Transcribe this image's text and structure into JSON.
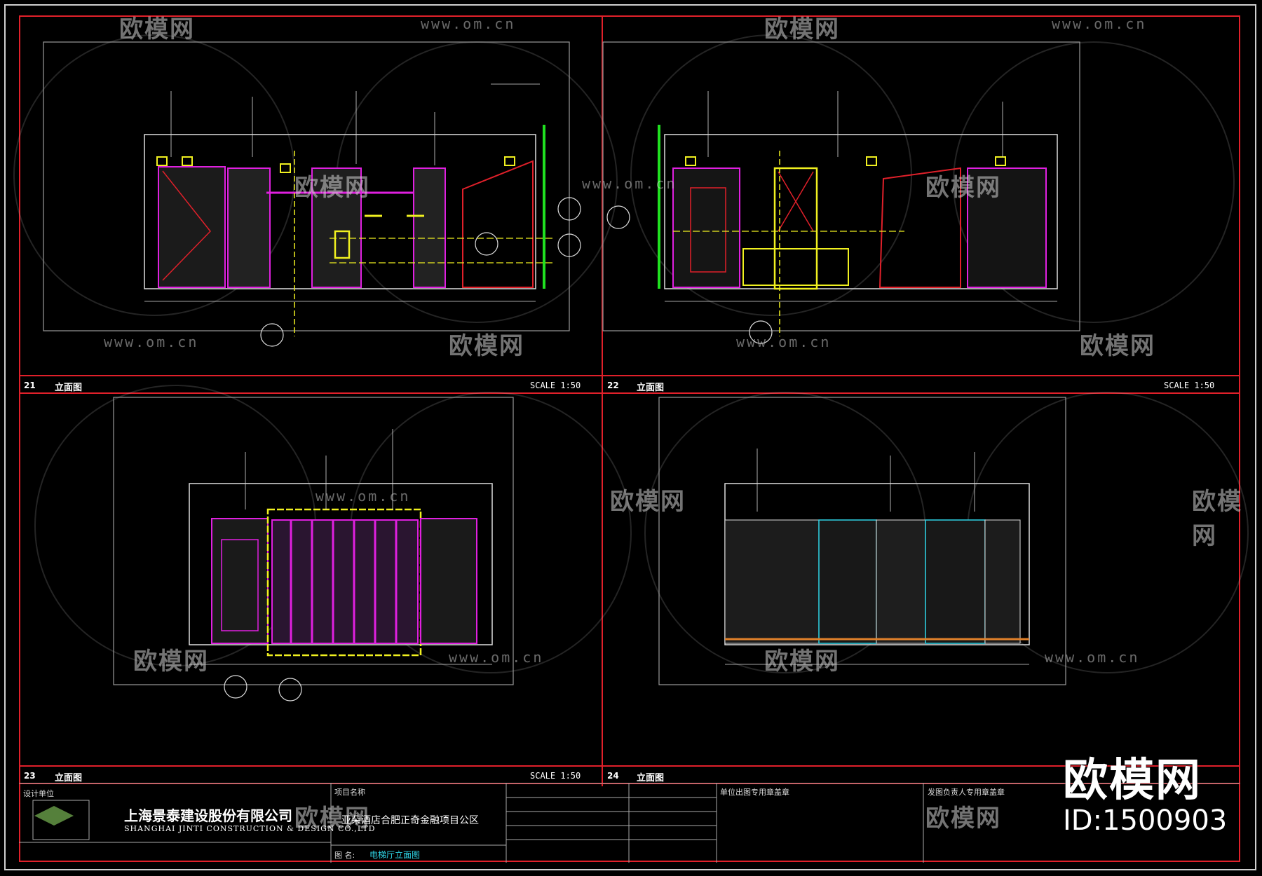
{
  "panels": [
    {
      "number": "21",
      "title": "立面图",
      "scale": "SCALE  1:50"
    },
    {
      "number": "22",
      "title": "立面图",
      "scale": "SCALE  1:50"
    },
    {
      "number": "23",
      "title": "立面图",
      "scale": "SCALE  1:50"
    },
    {
      "number": "24",
      "title": "立面图",
      "scale": ""
    }
  ],
  "watermark": {
    "brand": "欧模网",
    "url": "www.om.cn"
  },
  "overlay": {
    "brand": "欧模网",
    "id": "ID:1500903"
  },
  "title_block": {
    "designer_label": "设计单位",
    "company_cn": "上海景泰建设股份有限公司",
    "company_en": "SHANGHAI JINTI CONSTRUCTION & DESIGN CO.,LTD",
    "project_label": "项目名称",
    "project_name": "亚朵酒店合肥正奇金融项目公区",
    "drawing_label": "图  名:",
    "drawing_name": "电梯厅立面图",
    "unit_label": "单位出图专用章盖章",
    "approval_label": "发图负责人专用章盖章"
  },
  "colors": {
    "frame_red": "#e0202a",
    "magenta": "#e020e0",
    "yellow": "#f0f020",
    "green": "#20e020",
    "cyan": "#2fd6e8"
  }
}
